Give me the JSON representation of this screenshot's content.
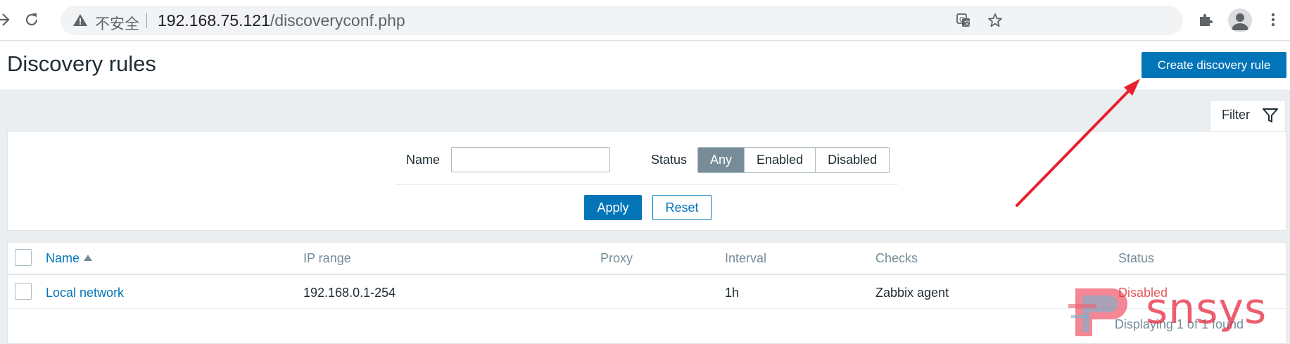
{
  "browser": {
    "security_label": "不安全",
    "url_host": "192.168.75.121",
    "url_path": "/discoveryconf.php"
  },
  "page": {
    "title": "Discovery rules",
    "create_button": "Create discovery rule"
  },
  "filter": {
    "tab_label": "Filter",
    "name_label": "Name",
    "name_value": "",
    "status_label": "Status",
    "status_options": [
      "Any",
      "Enabled",
      "Disabled"
    ],
    "status_selected": "Any",
    "apply_label": "Apply",
    "reset_label": "Reset"
  },
  "table": {
    "columns": [
      "Name",
      "IP range",
      "Proxy",
      "Interval",
      "Checks",
      "Status"
    ],
    "sort_column": "Name",
    "sort_direction": "ascending",
    "rows": [
      {
        "name": "Local network",
        "ip_range": "192.168.0.1-254",
        "proxy": "",
        "interval": "1h",
        "checks": "Zabbix agent",
        "status": "Disabled"
      }
    ],
    "footer": "Displaying 1 of 1 found"
  },
  "watermark": {
    "text": "snsys"
  },
  "colors": {
    "accent": "#0275b8",
    "status_disabled": "#e45959",
    "segment_active": "#768d99",
    "annotation_arrow": "#e8202f"
  },
  "icons": {
    "back": "arrow-left-icon",
    "reload": "reload-icon",
    "security": "warning-triangle-icon",
    "translate": "translate-icon",
    "bookmark": "star-icon",
    "extensions": "puzzle-icon",
    "profile": "avatar-icon",
    "menu": "kebab-menu-icon",
    "filter": "funnel-icon"
  }
}
